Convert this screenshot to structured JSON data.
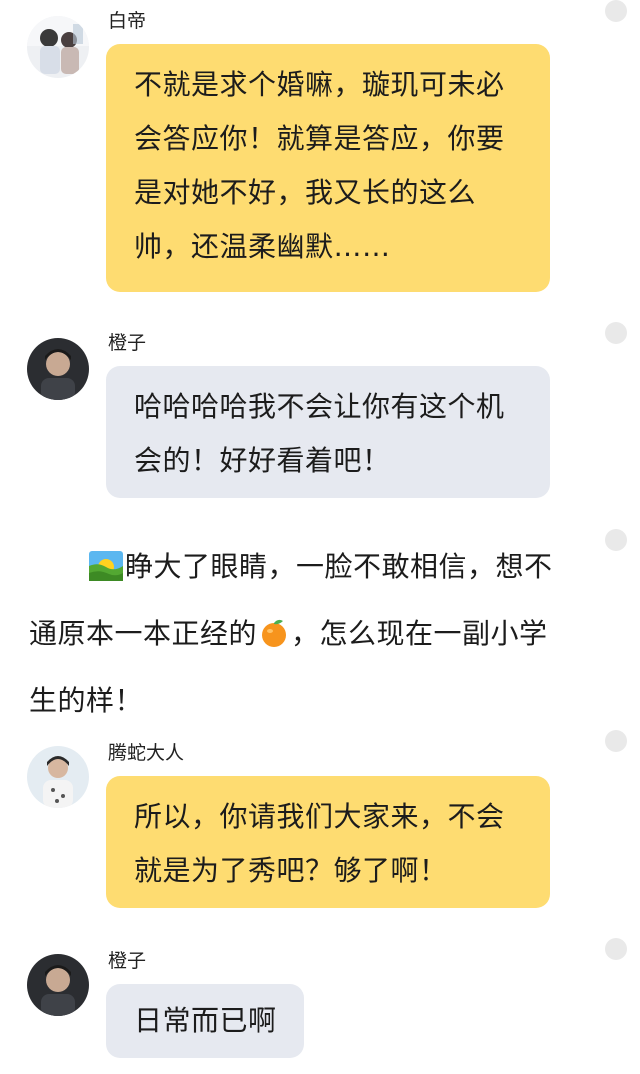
{
  "chat": {
    "messages": [
      {
        "sender": "白帝",
        "bubble_color": "#fedc71",
        "lines": [
          "不就是求个婚嘛，璇玑可未必",
          "会答应你！就算是答应，你要",
          "是对她不好，我又长的这么",
          "帅，还温柔幽默……"
        ]
      },
      {
        "sender": "橙子",
        "bubble_color": "#e6e9f0",
        "lines": [
          "哈哈哈哈我不会让你有这个机",
          "会的！好好看着吧！"
        ]
      },
      {
        "sender": "腾蛇大人",
        "bubble_color": "#fedc71",
        "lines": [
          "所以，你请我们大家来，不会",
          "就是为了秀吧？够了啊！"
        ]
      },
      {
        "sender": "橙子",
        "bubble_color": "#e6e9f0",
        "lines": [
          "日常而已啊"
        ]
      }
    ],
    "narration": {
      "lines": [
        {
          "before": "",
          "emoji": "sunrise-emoji",
          "after": "睁大了眼睛，一脸不敢相信，想不"
        },
        {
          "before": "通原本一本正经的",
          "emoji": "orange-emoji",
          "after": "，怎么现在一副小学"
        },
        {
          "before": "生的样！",
          "emoji": "",
          "after": ""
        }
      ]
    }
  },
  "colors": {
    "yellow_bubble": "#fedc71",
    "gray_bubble": "#e6e9f0",
    "dot": "#e9e9e9"
  }
}
